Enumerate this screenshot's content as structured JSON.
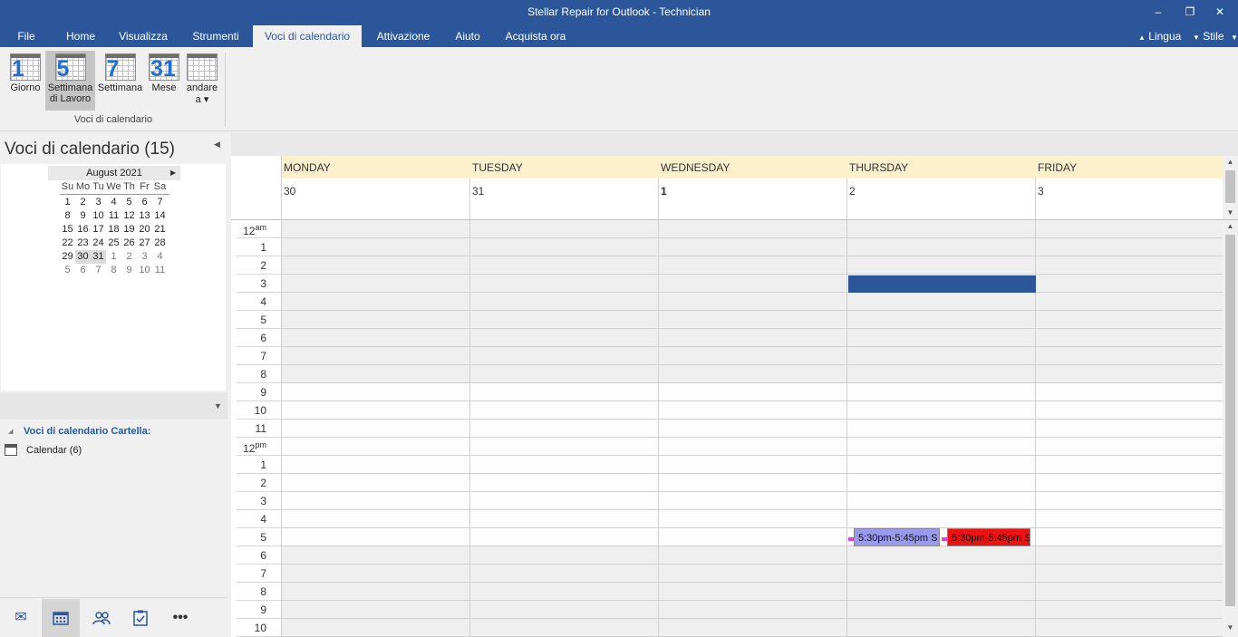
{
  "window": {
    "title": "Stellar Repair for Outlook - Technician",
    "minimize": "–",
    "restore": "❐",
    "close": "✕"
  },
  "menu": {
    "items": [
      "File",
      "Home",
      "Visualizza",
      "Strumenti",
      "Voci di calendario",
      "Attivazione",
      "Aiuto",
      "Acquista ora"
    ],
    "active_index": 4,
    "language": "Lingua",
    "style": "Stile"
  },
  "ribbon": {
    "buttons": [
      {
        "number": "1",
        "label1": "Giorno",
        "label2": ""
      },
      {
        "number": "5",
        "label1": "Settimana",
        "label2": "di Lavoro"
      },
      {
        "number": "7",
        "label1": "Settimana",
        "label2": ""
      },
      {
        "number": "31",
        "label1": "Mese",
        "label2": ""
      },
      {
        "number": "",
        "label1": "andare",
        "label2": "a ▾"
      }
    ],
    "selected_index": 1,
    "group_label": "Voci di calendario"
  },
  "left_pane": {
    "title": "Voci di calendario (15)",
    "mini_calendar": {
      "month": "August 2021",
      "weekdays": [
        "Su",
        "Mo",
        "Tu",
        "We",
        "Th",
        "Fr",
        "Sa"
      ],
      "weeks": [
        [
          "",
          "",
          "",
          "",
          "",
          "",
          ""
        ],
        [
          "1",
          "2",
          "3",
          "4",
          "5",
          "6",
          "7"
        ],
        [
          "8",
          "9",
          "10",
          "11",
          "12",
          "13",
          "14"
        ],
        [
          "15",
          "16",
          "17",
          "18",
          "19",
          "20",
          "21"
        ],
        [
          "22",
          "23",
          "24",
          "25",
          "26",
          "27",
          "28"
        ],
        [
          "29",
          "30",
          "31",
          "1",
          "2",
          "3",
          "4"
        ],
        [
          "5",
          "6",
          "7",
          "8",
          "9",
          "10",
          "11"
        ]
      ]
    },
    "folder_header": "Voci di calendario Cartella:",
    "folder_item": "Calendar (6)"
  },
  "calendar": {
    "days": [
      {
        "name": "MONDAY",
        "date": "30",
        "bold": false
      },
      {
        "name": "TUESDAY",
        "date": "31",
        "bold": false
      },
      {
        "name": "WEDNESDAY",
        "date": "1",
        "bold": true
      },
      {
        "name": "THURSDAY",
        "date": "2",
        "bold": false
      },
      {
        "name": "FRIDAY",
        "date": "3",
        "bold": false
      }
    ],
    "hours": [
      "12",
      "1",
      "2",
      "3",
      "4",
      "5",
      "6",
      "7",
      "8",
      "9",
      "10",
      "11",
      "12",
      "1",
      "2",
      "3",
      "4",
      "5",
      "6",
      "7",
      "8",
      "9",
      "10"
    ],
    "am_label": "am",
    "pm_label": "pm",
    "appointments": [
      {
        "text": "5:30pm-5:45pm S",
        "color": "#9999ee"
      },
      {
        "text": "5:30pm-5:45pm S",
        "color": "#ee1111"
      }
    ],
    "busy_color": "#2b579a"
  }
}
